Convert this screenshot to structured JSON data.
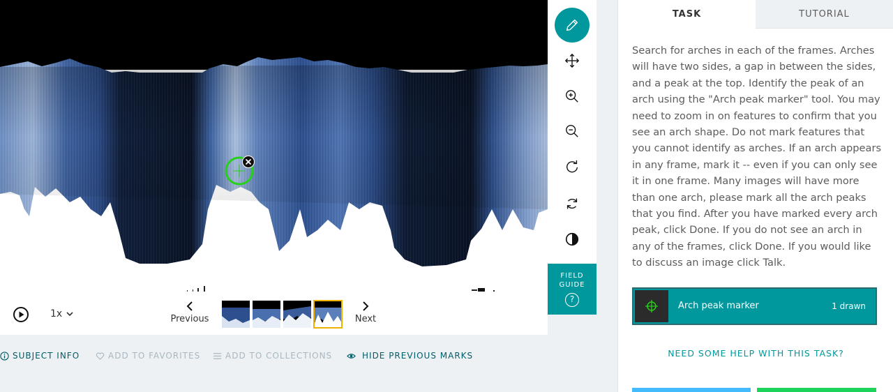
{
  "viewer": {
    "speed": "1x",
    "previous_label": "Previous",
    "next_label": "Next",
    "frames_count": 4,
    "active_frame": 4
  },
  "toolbar": {
    "field_guide_line1": "FIELD",
    "field_guide_line2": "GUIDE",
    "field_guide_icon": "?"
  },
  "meta_bar": {
    "subject_info": "SUBJECT INFO",
    "add_to_favorites": "ADD TO FAVORITES",
    "add_to_collections": "ADD TO COLLECTIONS",
    "hide_previous_marks": "HIDE PREVIOUS MARKS"
  },
  "task_panel": {
    "tabs": [
      {
        "label": "TASK"
      },
      {
        "label": "TUTORIAL"
      }
    ],
    "instructions": "Search for arches in each of the frames. Arches will have two sides, a gap in between the sides, and a peak at the top. Identify the peak of an arch using the \"Arch peak marker\" tool. You may need to zoom in on features to confirm that you see an arch shape. Do not mark features that you cannot identify as arches. If an arch appears in any frame, mark it -- even if you can only see it in one frame. Many images will have more than one arch, please mark all the arch peaks that you find. After you have marked every arch peak, click Done. If you do not see an arch in any of the frames, click Done. If you would like to discuss an image click Talk.",
    "tool_option": {
      "label": "Arch peak marker",
      "count": "1 drawn"
    },
    "help_link": "NEED SOME HELP WITH THIS TASK?"
  },
  "colors": {
    "teal": "#00979d",
    "mark_green": "#27d01a",
    "frame_highlight": "#f0b200"
  }
}
